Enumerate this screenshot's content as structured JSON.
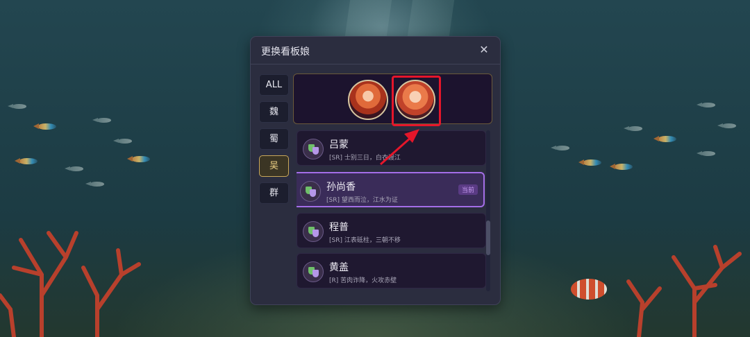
{
  "dialog": {
    "title": "更换看板娘",
    "close_glyph": "✕"
  },
  "tabs": [
    {
      "label": "ALL",
      "active": false
    },
    {
      "label": "魏",
      "active": false
    },
    {
      "label": "蜀",
      "active": false
    },
    {
      "label": "吴",
      "active": true
    },
    {
      "label": "群",
      "active": false
    }
  ],
  "preview": {
    "avatars": [
      "avatar-portrait",
      "avatar-portrait"
    ],
    "highlight_color": "#e5162a"
  },
  "characters": [
    {
      "name": "吕蒙",
      "desc": "[SR] 士别三日，白衣渡江",
      "current": false,
      "badge": ""
    },
    {
      "name": "孙尚香",
      "desc": "[SR] 望西而泣，江水为证",
      "current": true,
      "badge": "当前"
    },
    {
      "name": "程普",
      "desc": "[SR] 江表砥柱，三朝不移",
      "current": false,
      "badge": ""
    },
    {
      "name": "黄盖",
      "desc": "[R] 苦肉诈降，火攻赤壁",
      "current": false,
      "badge": ""
    }
  ],
  "colors": {
    "accent_purple": "#a46ee8",
    "accent_gold": "#c9a85a",
    "annotation_red": "#e5162a"
  }
}
